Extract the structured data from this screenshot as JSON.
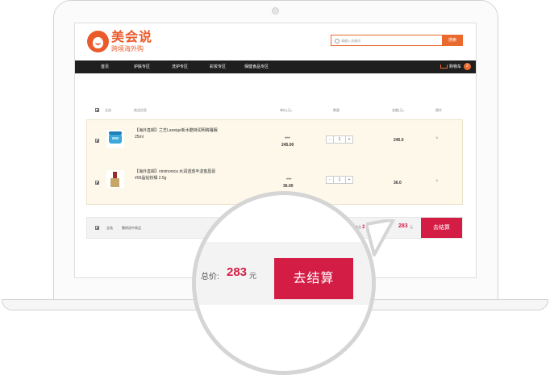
{
  "header": {
    "logo_main": "美会说",
    "logo_sub": "跨境海外购",
    "search_placeholder": "请输入关键词",
    "search_button": "搜索"
  },
  "nav": {
    "items": [
      "首页",
      "护肤专区",
      "洗护专区",
      "彩妆专区",
      "保健食品专区"
    ],
    "cart_label": "购物车",
    "cart_count": "2"
  },
  "table": {
    "select_all": "全选",
    "columns": [
      "商品信息",
      "单价(元)",
      "数量",
      "金额(元)",
      "操作"
    ]
  },
  "items": [
    {
      "title": "【海外直邮】兰芝Laneige新水酷特润明眸睡眠",
      "title2": "25ml",
      "old_price": "380",
      "price": "245.00",
      "qty": "1",
      "amount": "245.0",
      "delete": "×",
      "minus": "-",
      "plus": "+"
    },
    {
      "title": "【海外直邮】ninimonica 水润透惑丰漾蜜唇膏",
      "title2": "#09晶钻粉橘 2.5g",
      "old_price": "116",
      "price": "36.00",
      "qty": "1",
      "amount": "36.0",
      "delete": "×",
      "minus": "-",
      "plus": "+"
    }
  ],
  "footer": {
    "select_all": "全选",
    "delete_selected": "删除选中商品",
    "selected_prefix": "已选商品",
    "selected_count": "2",
    "selected_suffix": "件",
    "total_label": "总价:",
    "total_value": "283",
    "total_unit": "元",
    "checkout": "去结算"
  },
  "magnifier": {
    "total_label": "总价:",
    "total_value": "283",
    "total_unit": "元",
    "checkout": "去结算"
  },
  "colors": {
    "brand": "#ea5b2b",
    "checkout": "#d41d45",
    "nav_bg": "#1f1f1f"
  }
}
